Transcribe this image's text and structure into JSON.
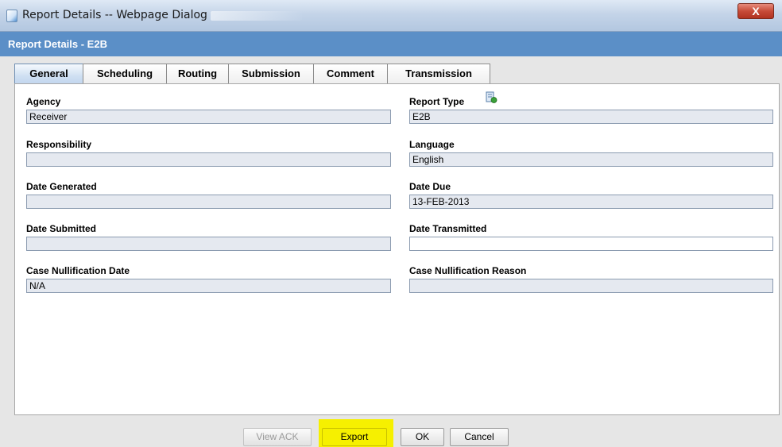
{
  "window": {
    "title": "Report Details -- Webpage Dialog",
    "close_label": "X"
  },
  "dialog": {
    "header": "Report Details - E2B"
  },
  "tabs": [
    {
      "label": "General",
      "active": true
    },
    {
      "label": "Scheduling",
      "active": false
    },
    {
      "label": "Routing",
      "active": false
    },
    {
      "label": "Submission",
      "active": false
    },
    {
      "label": "Comment",
      "active": false
    },
    {
      "label": "Transmission",
      "active": false
    }
  ],
  "fields": {
    "agency": {
      "label": "Agency",
      "value": "Receiver"
    },
    "report_type": {
      "label": "Report Type",
      "value": "E2B",
      "icon": "report-type-icon"
    },
    "responsibility": {
      "label": "Responsibility",
      "value": ""
    },
    "language": {
      "label": "Language",
      "value": "English"
    },
    "date_generated": {
      "label": "Date Generated",
      "value": ""
    },
    "date_due": {
      "label": "Date Due",
      "value": "13-FEB-2013"
    },
    "date_submitted": {
      "label": "Date Submitted",
      "value": ""
    },
    "date_transmitted": {
      "label": "Date Transmitted",
      "value": ""
    },
    "case_nullification_date": {
      "label": "Case Nullification Date",
      "value": "N/A"
    },
    "case_nullification_reason": {
      "label": "Case Nullification Reason",
      "value": ""
    }
  },
  "buttons": {
    "view_ack": "View ACK",
    "export": "Export",
    "ok": "OK",
    "cancel": "Cancel"
  },
  "colors": {
    "header_bg": "#5b8fc7",
    "export_highlight": "#f6f000",
    "input_bg": "#e5e9f0"
  }
}
